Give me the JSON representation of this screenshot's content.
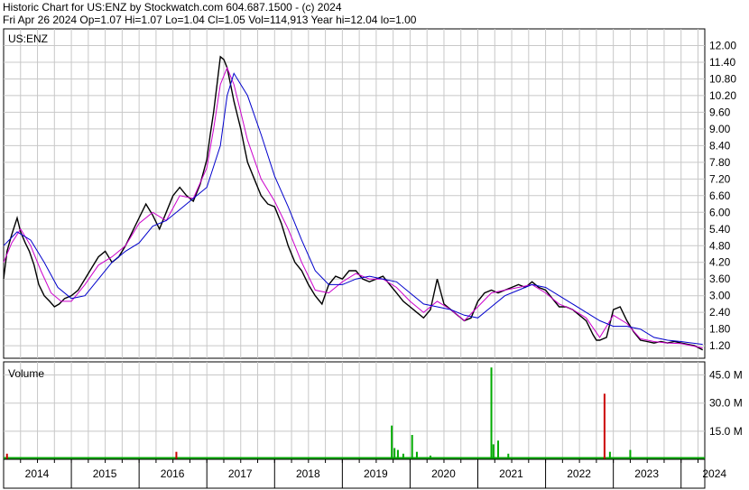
{
  "header": {
    "line1": "Historic Chart for US:ENZ by Stockwatch.com 604.687.1500 - (c) 2024",
    "line2": "Fri Apr 26 2024   Op=1.07  Hi=1.07  Lo=1.04  Cl=1.05  Vol=114,913  Year hi=12.04  lo=1.00"
  },
  "chart_data": [
    {
      "type": "line",
      "panel_label": "US:ENZ",
      "x_unit": "year",
      "y_ticks": [
        12.0,
        11.4,
        10.8,
        10.2,
        9.6,
        9.0,
        8.4,
        7.8,
        7.2,
        6.6,
        6.0,
        5.4,
        4.8,
        4.2,
        3.6,
        3.0,
        2.4,
        1.8,
        1.2
      ],
      "y_tick_labels": [
        "12.00",
        "11.40",
        "10.80",
        "10.20",
        "9.60",
        "9.00",
        "8.40",
        "7.80",
        "7.20",
        "6.60",
        "6.00",
        "5.40",
        "4.80",
        "4.20",
        "3.60",
        "3.00",
        "2.40",
        "1.80",
        "1.20"
      ],
      "ylim": [
        0.75,
        12.6
      ],
      "xlim": [
        2014.0,
        2024.35
      ],
      "grid": true,
      "series": [
        {
          "kind": "price",
          "color": "#000000",
          "x": [
            2014.0,
            2014.05,
            2014.12,
            2014.2,
            2014.25,
            2014.32,
            2014.38,
            2014.45,
            2014.52,
            2014.6,
            2014.68,
            2014.75,
            2014.82,
            2014.9,
            2015.0,
            2015.1,
            2015.2,
            2015.3,
            2015.4,
            2015.5,
            2015.6,
            2015.7,
            2015.8,
            2015.9,
            2016.0,
            2016.1,
            2016.2,
            2016.3,
            2016.4,
            2016.5,
            2016.6,
            2016.7,
            2016.8,
            2016.9,
            2017.0,
            2017.05,
            2017.1,
            2017.15,
            2017.2,
            2017.25,
            2017.3,
            2017.35,
            2017.4,
            2017.45,
            2017.5,
            2017.55,
            2017.6,
            2017.7,
            2017.8,
            2017.9,
            2018.0,
            2018.1,
            2018.2,
            2018.3,
            2018.4,
            2018.5,
            2018.6,
            2018.7,
            2018.8,
            2018.9,
            2019.0,
            2019.1,
            2019.2,
            2019.3,
            2019.4,
            2019.5,
            2019.6,
            2019.7,
            2019.8,
            2019.9,
            2020.0,
            2020.1,
            2020.2,
            2020.3,
            2020.4,
            2020.5,
            2020.6,
            2020.7,
            2020.8,
            2020.9,
            2021.0,
            2021.1,
            2021.2,
            2021.3,
            2021.4,
            2021.5,
            2021.6,
            2021.7,
            2021.8,
            2021.9,
            2022.0,
            2022.1,
            2022.2,
            2022.3,
            2022.4,
            2022.5,
            2022.6,
            2022.7,
            2022.75,
            2022.8,
            2022.9,
            2023.0,
            2023.1,
            2023.2,
            2023.3,
            2023.4,
            2023.5,
            2023.6,
            2023.7,
            2023.8,
            2023.9,
            2024.0,
            2024.1,
            2024.2,
            2024.32
          ],
          "y": [
            3.6,
            4.6,
            5.2,
            5.8,
            5.3,
            4.9,
            4.6,
            4.1,
            3.4,
            3.0,
            2.8,
            2.6,
            2.7,
            2.9,
            3.0,
            3.2,
            3.6,
            4.0,
            4.4,
            4.6,
            4.2,
            4.4,
            4.8,
            5.3,
            5.8,
            6.3,
            5.9,
            5.4,
            6.0,
            6.6,
            6.9,
            6.6,
            6.4,
            7.0,
            7.9,
            8.8,
            9.6,
            10.6,
            11.6,
            11.5,
            11.2,
            10.6,
            10.0,
            9.5,
            9.0,
            8.4,
            7.8,
            7.2,
            6.6,
            6.3,
            6.2,
            5.6,
            4.8,
            4.2,
            3.9,
            3.4,
            3.0,
            2.7,
            3.4,
            3.7,
            3.6,
            3.9,
            3.9,
            3.6,
            3.5,
            3.6,
            3.7,
            3.4,
            3.1,
            2.8,
            2.6,
            2.4,
            2.2,
            2.5,
            3.6,
            2.7,
            2.5,
            2.3,
            2.1,
            2.2,
            2.8,
            3.1,
            3.2,
            3.1,
            3.2,
            3.3,
            3.4,
            3.3,
            3.5,
            3.3,
            3.2,
            2.9,
            2.6,
            2.6,
            2.5,
            2.3,
            2.1,
            1.6,
            1.4,
            1.4,
            1.5,
            2.5,
            2.6,
            2.1,
            1.7,
            1.4,
            1.35,
            1.3,
            1.35,
            1.3,
            1.35,
            1.3,
            1.25,
            1.2,
            1.05
          ]
        },
        {
          "kind": "short-ma",
          "color": "#cc00cc",
          "x": [
            2014.0,
            2014.12,
            2014.25,
            2014.4,
            2014.55,
            2014.7,
            2014.85,
            2015.0,
            2015.2,
            2015.4,
            2015.6,
            2015.8,
            2016.0,
            2016.2,
            2016.4,
            2016.6,
            2016.8,
            2017.0,
            2017.1,
            2017.2,
            2017.3,
            2017.4,
            2017.5,
            2017.6,
            2017.8,
            2018.0,
            2018.2,
            2018.4,
            2018.6,
            2018.8,
            2019.0,
            2019.2,
            2019.4,
            2019.6,
            2019.8,
            2020.0,
            2020.2,
            2020.4,
            2020.6,
            2020.8,
            2021.0,
            2021.2,
            2021.4,
            2021.6,
            2021.8,
            2022.0,
            2022.2,
            2022.4,
            2022.6,
            2022.8,
            2023.0,
            2023.2,
            2023.4,
            2023.6,
            2023.8,
            2024.0,
            2024.32
          ],
          "y": [
            4.2,
            4.9,
            5.4,
            4.8,
            3.9,
            3.1,
            2.8,
            2.8,
            3.4,
            4.1,
            4.4,
            4.8,
            5.6,
            6.0,
            5.7,
            6.6,
            6.5,
            7.6,
            9.0,
            10.6,
            11.2,
            10.6,
            9.6,
            8.6,
            7.2,
            6.4,
            5.4,
            4.2,
            3.2,
            3.1,
            3.5,
            3.8,
            3.6,
            3.6,
            3.3,
            2.8,
            2.4,
            2.8,
            2.5,
            2.1,
            2.6,
            3.1,
            3.2,
            3.3,
            3.4,
            3.1,
            2.7,
            2.5,
            2.2,
            1.5,
            2.3,
            2.0,
            1.45,
            1.35,
            1.3,
            1.28,
            1.12
          ]
        },
        {
          "kind": "long-ma",
          "color": "#0000cc",
          "x": [
            2014.0,
            2014.2,
            2014.4,
            2014.6,
            2014.8,
            2015.0,
            2015.2,
            2015.4,
            2015.6,
            2015.8,
            2016.0,
            2016.2,
            2016.4,
            2016.6,
            2016.8,
            2017.0,
            2017.2,
            2017.3,
            2017.4,
            2017.6,
            2017.8,
            2018.0,
            2018.2,
            2018.4,
            2018.6,
            2018.8,
            2019.0,
            2019.2,
            2019.4,
            2019.6,
            2019.8,
            2020.0,
            2020.2,
            2020.4,
            2020.6,
            2020.8,
            2021.0,
            2021.2,
            2021.4,
            2021.6,
            2021.8,
            2022.0,
            2022.2,
            2022.4,
            2022.6,
            2022.8,
            2023.0,
            2023.2,
            2023.4,
            2023.6,
            2023.8,
            2024.0,
            2024.32
          ],
          "y": [
            4.8,
            5.3,
            5.0,
            4.2,
            3.3,
            2.9,
            3.0,
            3.6,
            4.2,
            4.6,
            4.9,
            5.5,
            5.7,
            6.1,
            6.5,
            6.9,
            8.4,
            10.2,
            11.0,
            10.2,
            8.8,
            7.3,
            6.2,
            5.0,
            3.9,
            3.4,
            3.4,
            3.6,
            3.7,
            3.6,
            3.5,
            3.1,
            2.7,
            2.6,
            2.5,
            2.3,
            2.2,
            2.6,
            3.0,
            3.2,
            3.4,
            3.3,
            3.0,
            2.7,
            2.4,
            2.1,
            1.9,
            1.9,
            1.8,
            1.5,
            1.4,
            1.35,
            1.25
          ]
        }
      ],
      "x_tick_labels": [
        "2014",
        "2015",
        "2016",
        "2017",
        "2018",
        "2019",
        "2020",
        "2021",
        "2022",
        "2023",
        "2024"
      ],
      "x_ticks": [
        2014.0,
        2015.0,
        2016.0,
        2017.0,
        2018.0,
        2019.0,
        2020.0,
        2021.0,
        2022.0,
        2023.0,
        2024.0
      ]
    },
    {
      "type": "bar",
      "panel_label": "Volume",
      "y_unit": "M",
      "y_ticks": [
        45.0,
        30.0,
        15.0
      ],
      "y_tick_labels": [
        "45.0 M",
        "30.0 M",
        "15.0 M"
      ],
      "ylim": [
        0,
        52
      ],
      "grid": true,
      "x": [
        2014.05,
        2014.3,
        2014.6,
        2014.9,
        2015.2,
        2015.5,
        2015.8,
        2016.1,
        2016.4,
        2016.55,
        2016.8,
        2017.1,
        2017.4,
        2017.7,
        2018.0,
        2018.3,
        2018.6,
        2018.9,
        2019.2,
        2019.5,
        2019.7,
        2019.73,
        2019.77,
        2019.82,
        2019.9,
        2020.03,
        2020.1,
        2020.3,
        2020.6,
        2020.9,
        2021.1,
        2021.2,
        2021.23,
        2021.3,
        2021.45,
        2021.7,
        2022.0,
        2022.3,
        2022.6,
        2022.8,
        2022.87,
        2022.95,
        2023.1,
        2023.25,
        2023.5,
        2023.8,
        2024.1
      ],
      "values": [
        3,
        1,
        1,
        1,
        1,
        1,
        1,
        1,
        1,
        4,
        1,
        1,
        1,
        1,
        1,
        1,
        1,
        1,
        1,
        1,
        1,
        18,
        6,
        5,
        3,
        13,
        4,
        2,
        1,
        1,
        1,
        49,
        8,
        10,
        3,
        1,
        1,
        1,
        1,
        1,
        35,
        4,
        1,
        5,
        1,
        1,
        1
      ],
      "color": "#00aa00",
      "highlight_color": "#cc0000",
      "highlight": [
        2014.05,
        2016.55,
        2022.87
      ]
    }
  ]
}
